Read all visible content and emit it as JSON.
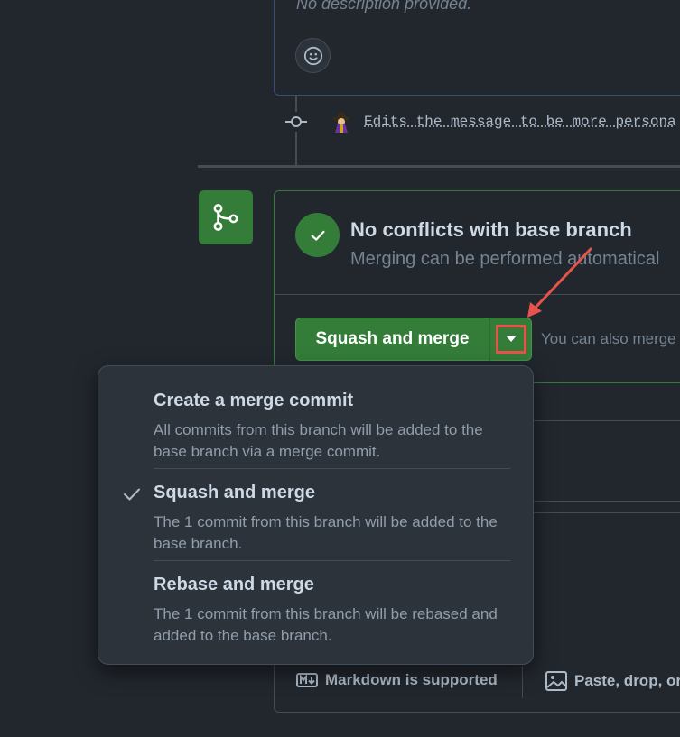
{
  "comment": {
    "description": "No description provided."
  },
  "timeline": {
    "commit_message": "Edits the message to be more persona"
  },
  "merge_status": {
    "title": "No conflicts with base branch",
    "subtitle": "Merging can be performed automatical"
  },
  "merge_button": {
    "label": "Squash and merge",
    "also_text": "You can also merge"
  },
  "merge_menu": {
    "items": [
      {
        "title": "Create a merge commit",
        "description": "All commits from this branch will be added to the base branch via a merge commit.",
        "selected": false
      },
      {
        "title": "Squash and merge",
        "description": "The 1 commit from this branch will be added to the base branch.",
        "selected": true
      },
      {
        "title": "Rebase and merge",
        "description": "The 1 commit from this branch will be rebased and added to the base branch.",
        "selected": false
      }
    ]
  },
  "footer": {
    "markdown_label": "Markdown is supported",
    "paste_label": "Paste, drop, or"
  },
  "icons": {
    "emoji": "smiley-icon",
    "commit": "git-commit-icon",
    "merge": "git-merge-icon",
    "status": "check-circle-icon",
    "dropdown": "triangle-down-icon",
    "menu_check": "check-icon",
    "markdown": "markdown-icon",
    "image": "image-icon"
  },
  "colors": {
    "background": "#22272e",
    "success": "#347d39",
    "annotation": "#e5534b",
    "menu_bg": "#2d333b"
  }
}
